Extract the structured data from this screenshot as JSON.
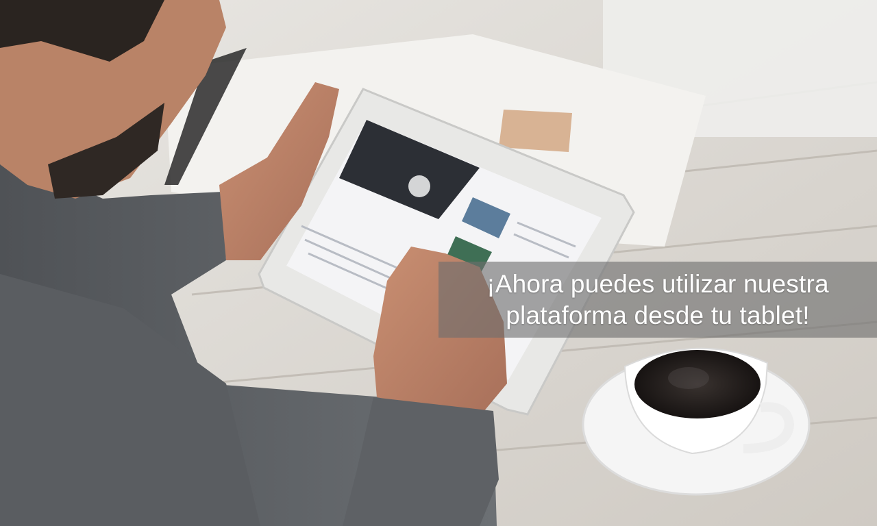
{
  "photo": {
    "description_icon": "photo-icon"
  },
  "banner": {
    "line1": "¡Ahora puedes utilizar nuestra",
    "line2": "plataforma desde tu tablet!"
  }
}
